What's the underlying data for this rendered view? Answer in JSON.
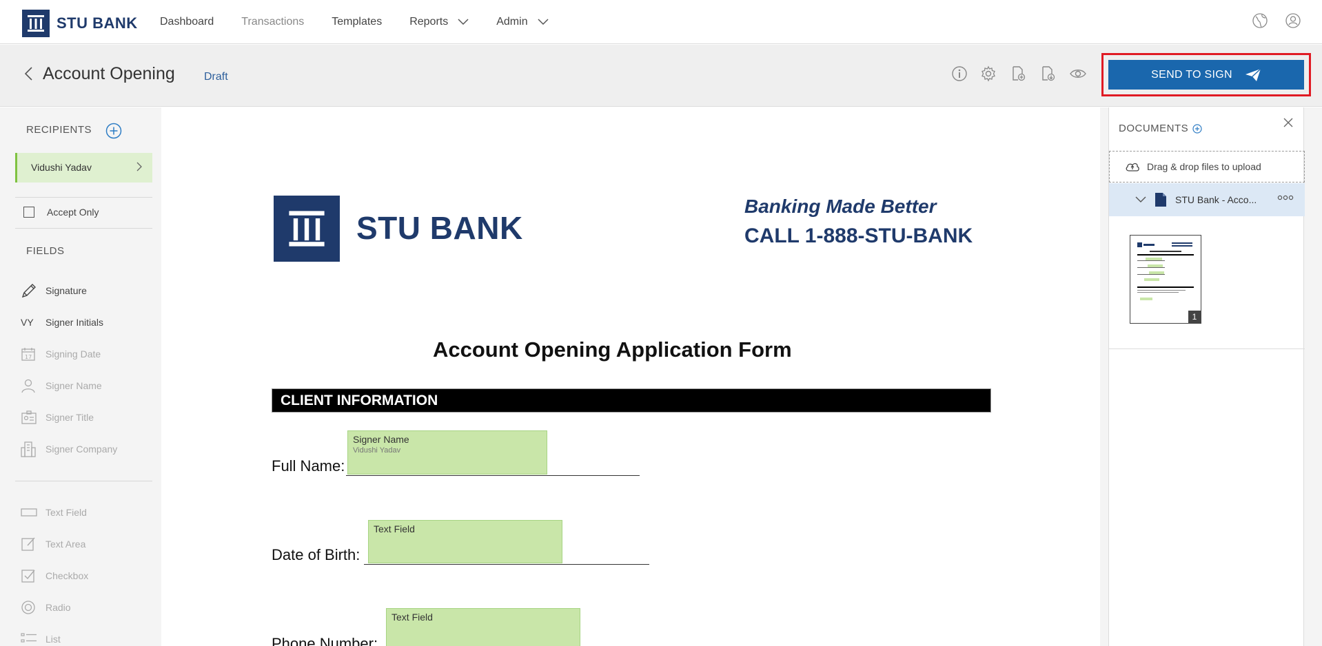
{
  "nav": {
    "brand": "STU BANK",
    "items": [
      "Dashboard",
      "Transactions",
      "Templates",
      "Reports",
      "Admin"
    ]
  },
  "header": {
    "title": "Account Opening",
    "status": "Draft",
    "send_label": "SEND TO SIGN"
  },
  "sidebar": {
    "recipients_title": "RECIPIENTS",
    "recipient": "Vidushi Yadav",
    "accept_only": "Accept Only",
    "fields_title": "FIELDS",
    "initials": "VY",
    "fields": [
      "Signature",
      "Signer Initials",
      "Signing Date",
      "Signer Name",
      "Signer Title",
      "Signer Company",
      "Text Field",
      "Text Area",
      "Checkbox",
      "Radio",
      "List"
    ]
  },
  "document": {
    "bank_name": "STU BANK",
    "tagline": "Banking Made Better",
    "phone": "CALL 1-888-STU-BANK",
    "form_title": "Account Opening Application Form",
    "section": "CLIENT INFORMATION",
    "labels": [
      "Full Name:",
      "Date of Birth:",
      "Phone Number:"
    ],
    "placed_fields": [
      {
        "label": "Signer Name",
        "value": "Vidushi Yadav"
      },
      {
        "label": "Text Field",
        "value": ""
      },
      {
        "label": "Text Field",
        "value": ""
      }
    ]
  },
  "documents_panel": {
    "title": "DOCUMENTS",
    "upload_text": "Drag & drop files to upload",
    "file_name": "STU Bank - Acco...",
    "page_number": "1"
  }
}
